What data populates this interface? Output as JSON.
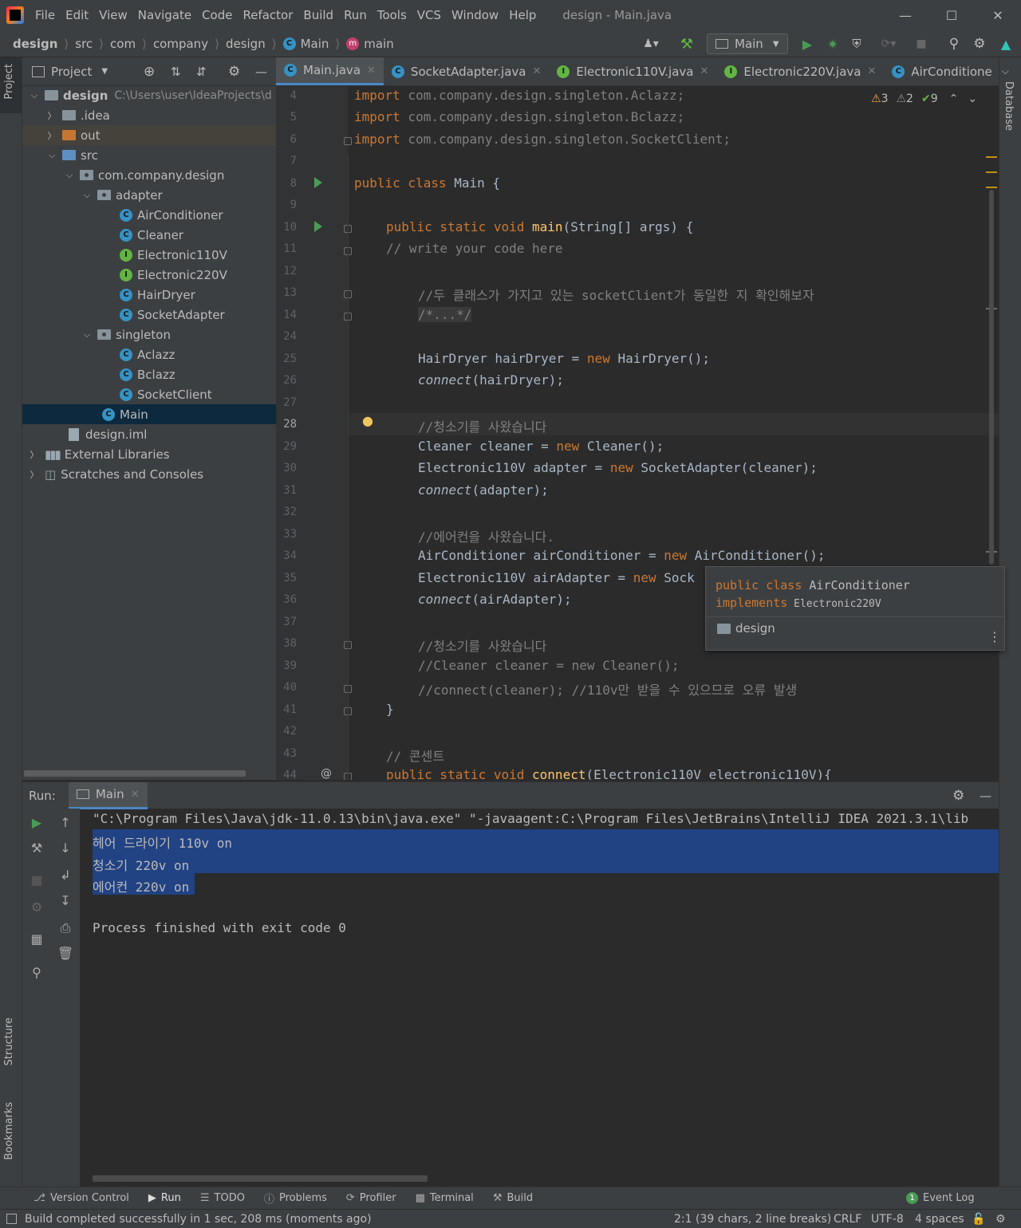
{
  "menubar": {
    "items": [
      "File",
      "Edit",
      "View",
      "Navigate",
      "Code",
      "Refactor",
      "Build",
      "Run",
      "Tools",
      "VCS",
      "Window",
      "Help"
    ],
    "title": "design - Main.java"
  },
  "navbar": {
    "crumbs": [
      "design",
      "src",
      "com",
      "company",
      "design",
      "Main",
      "main"
    ],
    "run_config": "Main"
  },
  "project": {
    "title": "Project",
    "root_label": "design",
    "root_path": "C:\\Users\\user\\IdeaProjects\\d",
    "items": [
      {
        "label": ".idea"
      },
      {
        "label": "out"
      },
      {
        "label": "src"
      },
      {
        "label": "com.company.design"
      },
      {
        "label": "adapter"
      },
      {
        "label": "AirConditioner"
      },
      {
        "label": "Cleaner"
      },
      {
        "label": "Electronic110V"
      },
      {
        "label": "Electronic220V"
      },
      {
        "label": "HairDryer"
      },
      {
        "label": "SocketAdapter"
      },
      {
        "label": "singleton"
      },
      {
        "label": "Aclazz"
      },
      {
        "label": "Bclazz"
      },
      {
        "label": "SocketClient"
      },
      {
        "label": "Main"
      },
      {
        "label": "design.iml"
      },
      {
        "label": "External Libraries"
      },
      {
        "label": "Scratches and Consoles"
      }
    ]
  },
  "tabs": [
    "Main.java",
    "SocketAdapter.java",
    "Electronic110V.java",
    "Electronic220V.java",
    "AirConditione"
  ],
  "inspections": {
    "warnings": "3",
    "weak_warnings": "2",
    "typos": "9"
  },
  "editor": {
    "line_numbers": [
      "4",
      "5",
      "6",
      "7",
      "8",
      "9",
      "10",
      "11",
      "12",
      "13",
      "14",
      "24",
      "25",
      "26",
      "27",
      "28",
      "29",
      "30",
      "31",
      "32",
      "33",
      "34",
      "35",
      "36",
      "37",
      "38",
      "39",
      "40",
      "41",
      "42",
      "43",
      "44"
    ],
    "current_line": "28",
    "code": {
      "l4_kw": "import",
      "l4": " com.company.design.singleton.Aclazz;",
      "l5_kw": "import",
      "l5": " com.company.design.singleton.Bclazz;",
      "l6_kw": "import",
      "l6": " com.company.design.singleton.SocketClient;",
      "l8_kw": "public class",
      "l8": " Main {",
      "l10_kw": "public static void",
      "l10_fn": "main",
      "l10": "(String[] args) {",
      "l11": "// write your code here",
      "l13": "//두 클래스가 가지고 있는 socketClient가 동일한 지 확인해보자",
      "l14": "/*...*/",
      "l25_a": "HairDryer hairDryer = ",
      "l25_kw": "new",
      "l25_b": " HairDryer();",
      "l26_it": "connect",
      "l26": "(hairDryer);",
      "l28": "//청소기를 사왔습니다",
      "l29_a": "Cleaner cleaner = ",
      "l29_kw": "new",
      "l29_b": " Cleaner();",
      "l30_a": "Electronic110V adapter = ",
      "l30_kw": "new",
      "l30_b": " SocketAdapter(cleaner);",
      "l31_it": "connect",
      "l31": "(adapter);",
      "l33": "//에어컨을 사왔습니다.",
      "l34_a": "AirConditioner airConditioner = ",
      "l34_kw": "new",
      "l34_b": " AirConditioner();",
      "l35_a": "Electronic110V airAdapter = ",
      "l35_kw": "new",
      "l35_b": " Sock",
      "l36_it": "connect",
      "l36": "(airAdapter);",
      "l38": "//청소기를 사왔습니다",
      "l39": "//Cleaner cleaner = new Cleaner();",
      "l40": "//connect(cleaner); //110v만 받을 수 있으므로 오류 발생",
      "l41": "}",
      "l43": "// 콘센트",
      "l44_kw": "public static void",
      "l44_fn": "connect",
      "l44": "(Electronic110V electronic110V){"
    }
  },
  "popup": {
    "kw1": "public class",
    "name": " AirConditioner",
    "kw2": "implements",
    "iface": " Electronic220V",
    "module": "design"
  },
  "run": {
    "label": "Run:",
    "tab": "Main",
    "cmd": "\"C:\\Program Files\\Java\\jdk-11.0.13\\bin\\java.exe\" \"-javaagent:C:\\Program Files\\JetBrains\\IntelliJ IDEA 2021.3.1\\lib",
    "out1": "헤어 드라이기 110v on",
    "out2": "청소기 220v on",
    "out3": "에어컨 220v on",
    "exit": "Process finished with exit code 0"
  },
  "side": {
    "project": "Project",
    "structure": "Structure",
    "bookmarks": "Bookmarks",
    "database": "Database"
  },
  "bottom_tabs": [
    "Version Control",
    "Run",
    "TODO",
    "Problems",
    "Profiler",
    "Terminal",
    "Build"
  ],
  "event_log": "Event Log",
  "event_count": "1",
  "status": {
    "message": "Build completed successfully in 1 sec, 208 ms (moments ago)",
    "position": "2:1 (39 chars, 2 line breaks)",
    "line_sep": "CRLF",
    "encoding": "UTF-8",
    "indent": "4 spaces"
  }
}
